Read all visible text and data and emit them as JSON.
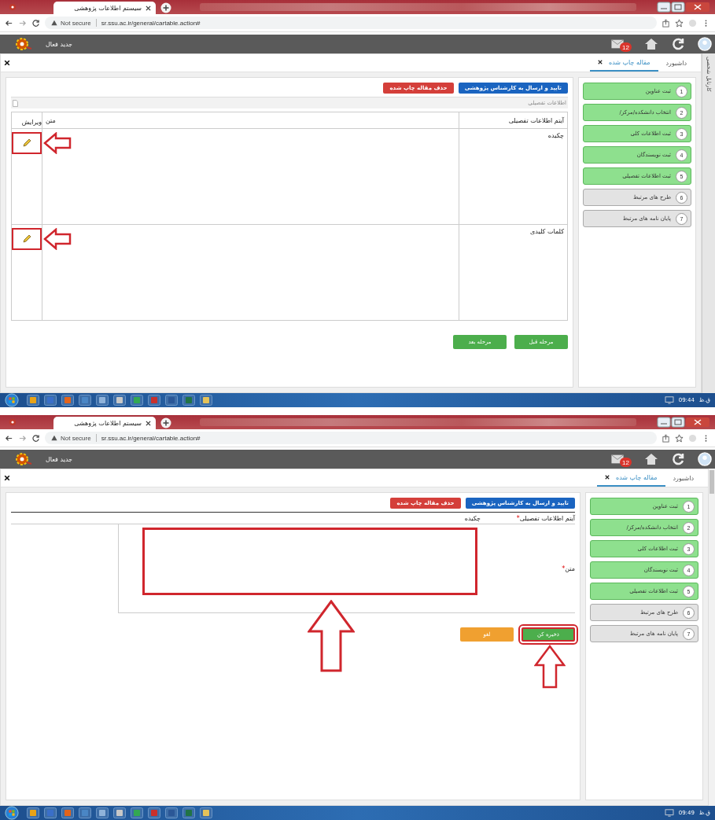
{
  "screens": [
    {
      "kind": "table",
      "browser": {
        "tab_title": "سیستم اطلاعات پژوهشی",
        "security": "Not secure",
        "url": "sr.ssu.ac.ir/general/cartable.action#"
      },
      "app": {
        "title": "جدید فعال",
        "mail_count": "12"
      },
      "side_tab": "کارتابل شخصی",
      "tabs": [
        {
          "label": "داشبورد",
          "selected": false,
          "closable": false
        },
        {
          "label": "مقاله چاپ شده",
          "selected": true,
          "closable": true
        }
      ],
      "actions": [
        {
          "label": "تایید و ارسال به کارشناس پژوهشی",
          "color": "#1a64c0"
        },
        {
          "label": "حذف مقاله چاپ شده",
          "color": "#d43f3a"
        }
      ],
      "section_title": "اطلاعات تفصیلی",
      "columns": [
        "آیتم اطلاعات تفصیلی",
        "متن",
        "ویرایش"
      ],
      "rows": [
        {
          "item": "چکیده",
          "highlighted": true
        },
        {
          "item": "کلمات کلیدی",
          "highlighted": true
        }
      ],
      "buttons": [
        {
          "label": "مرحله قبل",
          "color": "#4cae4c",
          "highlighted": false
        },
        {
          "label": "مرحله بعد",
          "color": "#4cae4c",
          "highlighted": false
        }
      ],
      "steps": [
        {
          "number": "1",
          "label": "ثبت عناوین",
          "done": true
        },
        {
          "number": "2",
          "label": "انتخاب دانشکده/مرکز/",
          "done": true
        },
        {
          "number": "3",
          "label": "ثبت اطلاعات کلی",
          "done": true
        },
        {
          "number": "4",
          "label": "ثبت نویسندگان",
          "done": true
        },
        {
          "number": "5",
          "label": "ثبت اطلاعات تفصیلی",
          "done": true
        },
        {
          "number": "6",
          "label": "طرح های مرتبط",
          "done": false
        },
        {
          "number": "7",
          "label": "پایان نامه های مرتبط",
          "done": false
        }
      ],
      "clock": {
        "time": "09:44",
        "period": "ق.ظ"
      }
    },
    {
      "kind": "form",
      "browser": {
        "tab_title": "سیستم اطلاعات پژوهشی",
        "security": "Not secure",
        "url": "sr.ssu.ac.ir/general/cartable.action#"
      },
      "app": {
        "title": "جدید فعال",
        "mail_count": "12"
      },
      "tabs": [
        {
          "label": "داشبورد",
          "selected": false,
          "closable": false
        },
        {
          "label": "مقاله چاپ شده",
          "selected": true,
          "closable": true
        }
      ],
      "actions": [
        {
          "label": "تایید و ارسال به کارشناس پژوهشی",
          "color": "#1a64c0"
        },
        {
          "label": "حذف مقاله چاپ شده",
          "color": "#d43f3a"
        }
      ],
      "field": {
        "label": "آیتم اطلاعات تفصیلی",
        "required_mark": "*",
        "value": "چکیده"
      },
      "text_field": {
        "label": "متن",
        "required_mark": "*",
        "highlighted": true
      },
      "buttons": [
        {
          "label": "ذخیره کن",
          "color": "#4cae4c",
          "highlighted": true
        },
        {
          "label": "لغو",
          "color": "#f0a030",
          "highlighted": false
        }
      ],
      "steps": [
        {
          "number": "1",
          "label": "ثبت عناوین",
          "done": true
        },
        {
          "number": "2",
          "label": "انتخاب دانشکده/مرکز/",
          "done": true
        },
        {
          "number": "3",
          "label": "ثبت اطلاعات کلی",
          "done": true
        },
        {
          "number": "4",
          "label": "ثبت نویسندگان",
          "done": true
        },
        {
          "number": "5",
          "label": "ثبت اطلاعات تفصیلی",
          "done": true
        },
        {
          "number": "6",
          "label": "طرح های مرتبط",
          "done": false
        },
        {
          "number": "7",
          "label": "پایان نامه های مرتبط",
          "done": false
        }
      ],
      "clock": {
        "time": "09:49",
        "period": "ق.ظ"
      }
    }
  ]
}
